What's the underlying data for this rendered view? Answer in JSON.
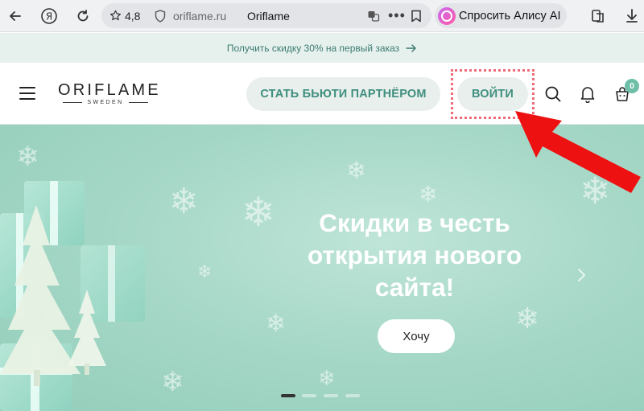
{
  "browser": {
    "rating": "4,8",
    "url": "oriflame.ru",
    "page_title": "Oriflame",
    "alice_label": "Спросить Алису AI"
  },
  "promo": {
    "text": "Получить скидку 30% на первый заказ"
  },
  "header": {
    "logo_main": "ORIFLAME",
    "logo_sub": "SWEDEN",
    "partner_button": "СТАТЬ БЬЮТИ ПАРТНЁРОМ",
    "login_button": "ВОЙТИ",
    "cart_count": "0"
  },
  "hero": {
    "title_line1": "Скидки в честь",
    "title_line2": "открытия нового",
    "title_line3": "сайта!",
    "cta": "Хочу",
    "slides_total": 4,
    "slide_active": 1
  },
  "colors": {
    "accent": "#3f8e7e",
    "hero_bg": "#a7d8c8",
    "highlight": "#f06a78",
    "arrow": "#ee1111"
  }
}
